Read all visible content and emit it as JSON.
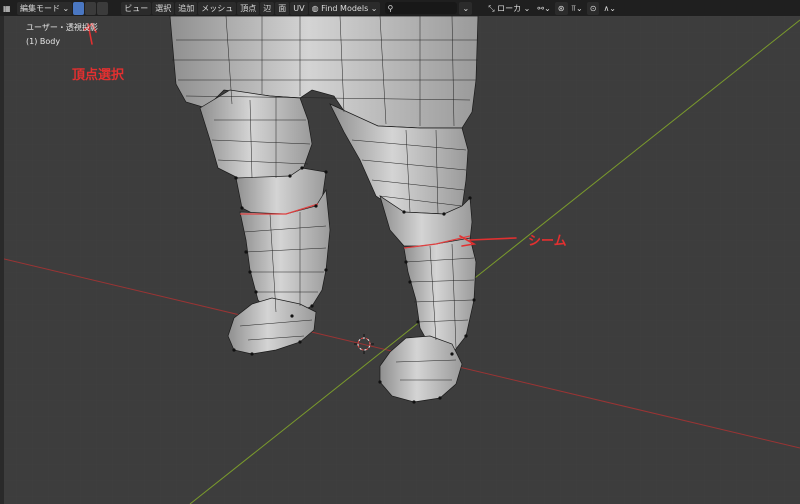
{
  "toolbar": {
    "mode_label": "編集モード",
    "menus": [
      "ビュー",
      "選択",
      "追加",
      "メッシュ",
      "頂点",
      "辺",
      "面",
      "UV"
    ],
    "find_models": "Find Models",
    "transform_orientation": "ローカ"
  },
  "viewport": {
    "view_name": "ユーザー・透視投影",
    "object_label": "(1) Body"
  },
  "annotations": {
    "vertex_select": "頂点選択",
    "seam": "シーム",
    "color": "#e23030"
  },
  "colors": {
    "background": "#3d3d3d",
    "toolbar": "#1f1f1f",
    "x_axis": "#9a3434",
    "y_axis": "#7a9a2c",
    "mesh": "#c6c6c6"
  }
}
